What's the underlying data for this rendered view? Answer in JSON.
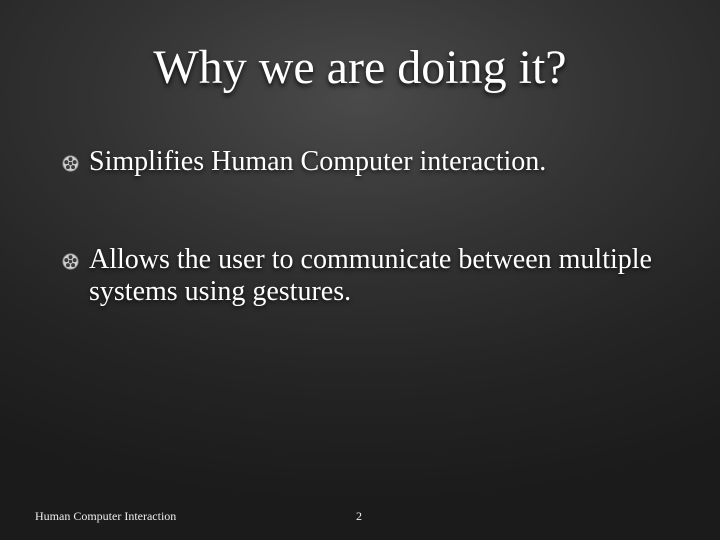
{
  "slide": {
    "title": "Why we are doing it?",
    "bullets": [
      {
        "icon": "film-reel-icon",
        "text": "Simplifies Human Computer interaction."
      },
      {
        "icon": "film-reel-icon",
        "text": "Allows the user to communicate between multiple systems using gestures."
      }
    ],
    "footer": "Human Computer Interaction",
    "page_number": "2"
  },
  "colors": {
    "text": "#ffffff",
    "background": "#2b2b2b"
  }
}
